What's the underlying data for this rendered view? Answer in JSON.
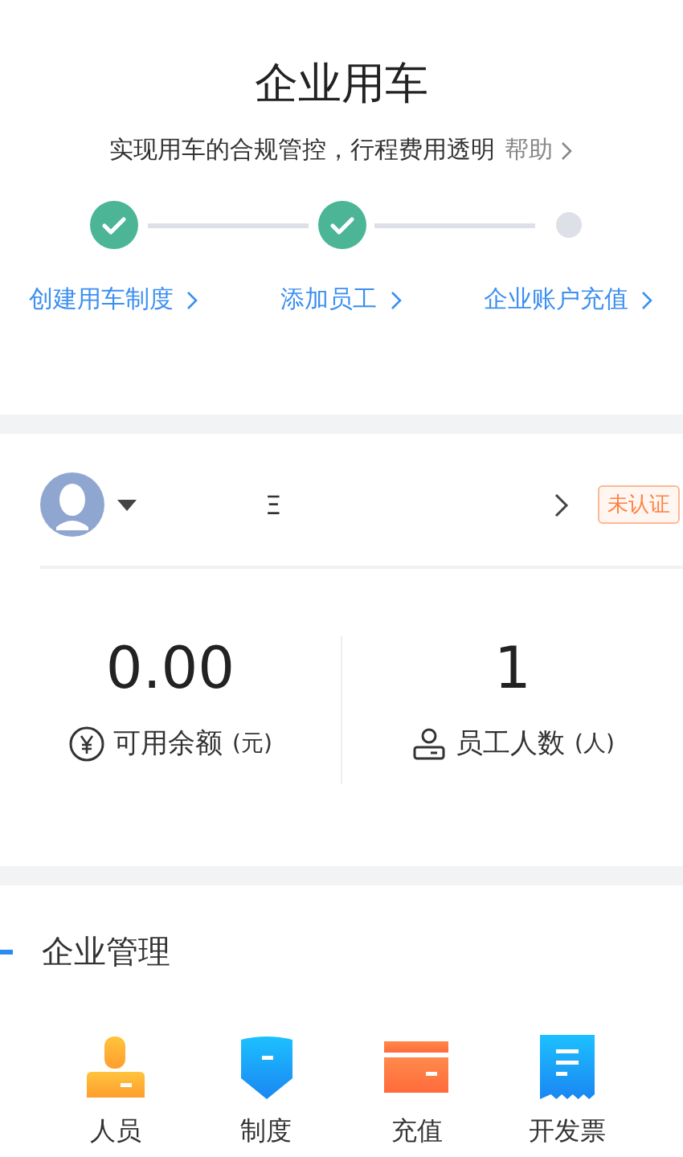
{
  "header": {
    "title": "企业用车",
    "subtitle": "实现用车的合规管控，行程费用透明",
    "help_link": "帮助"
  },
  "steps": [
    {
      "label": "创建用车制度",
      "done": true
    },
    {
      "label": "添加员工",
      "done": true
    },
    {
      "label": "企业账户充值",
      "done": false
    }
  ],
  "account": {
    "company_name": "Ξ",
    "badge": "未认证"
  },
  "stats": [
    {
      "kind": "balance",
      "value": "0.00",
      "label": "可用余额",
      "unit": "(元)"
    },
    {
      "kind": "staff",
      "value": "1",
      "label": "员工人数",
      "unit": "(人)"
    }
  ],
  "management": {
    "title": "企业管理",
    "items": [
      {
        "kind": "people",
        "label": "人员"
      },
      {
        "kind": "policy",
        "label": "制度"
      },
      {
        "kind": "recharge",
        "label": "充值"
      },
      {
        "kind": "invoice",
        "label": "开发票"
      }
    ]
  }
}
